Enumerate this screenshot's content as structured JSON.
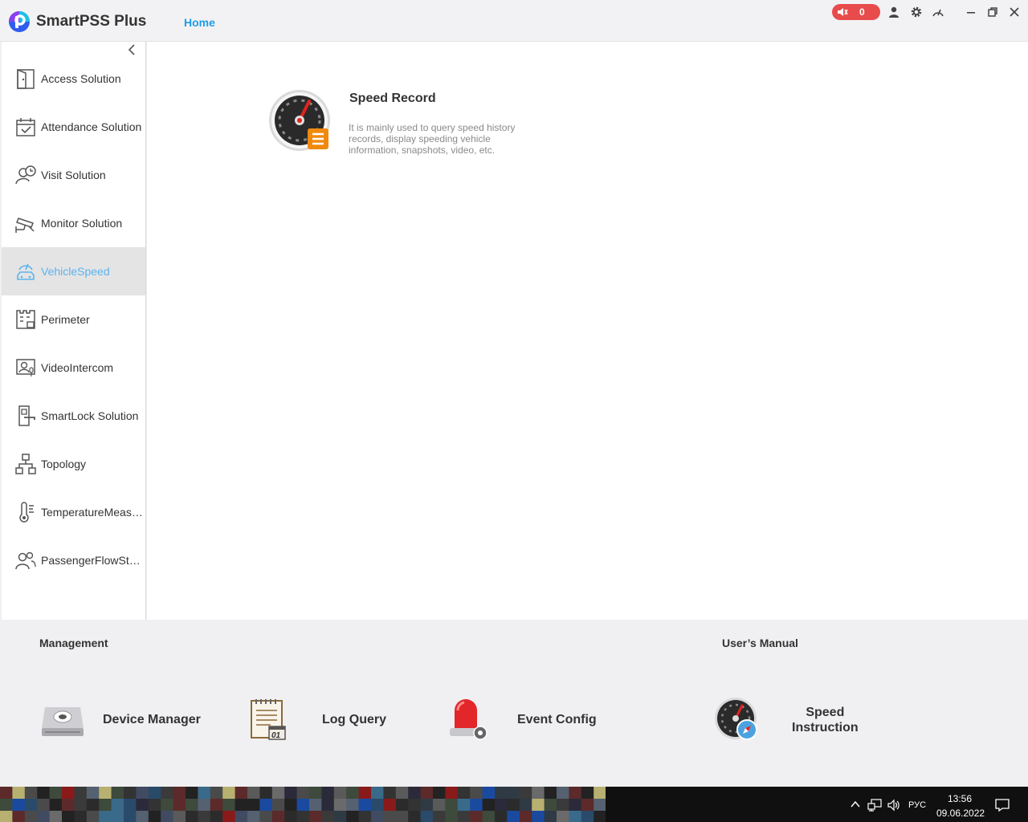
{
  "app": {
    "title": "SmartPSS Plus",
    "tab": "Home"
  },
  "alarm": {
    "count": "0"
  },
  "sidebar": {
    "items": [
      {
        "label": "Access Solution",
        "icon": "door-icon"
      },
      {
        "label": "Attendance Solution",
        "icon": "calendar-check-icon"
      },
      {
        "label": "Visit Solution",
        "icon": "visitor-clock-icon"
      },
      {
        "label": "Monitor Solution",
        "icon": "camera-icon"
      },
      {
        "label": "VehicleSpeed",
        "icon": "vehicle-speed-icon",
        "active": true
      },
      {
        "label": "Perimeter",
        "icon": "perimeter-icon"
      },
      {
        "label": "VideoIntercom",
        "icon": "intercom-icon"
      },
      {
        "label": "SmartLock Solution",
        "icon": "smartlock-icon"
      },
      {
        "label": "Topology",
        "icon": "topology-icon"
      },
      {
        "label": "TemperatureMeasurement",
        "icon": "thermometer-icon"
      },
      {
        "label": "PassengerFlowStatistics",
        "icon": "people-icon"
      }
    ]
  },
  "main": {
    "card": {
      "title": "Speed Record",
      "description": "It is mainly used to query speed history records, display speeding vehicle information, snapshots, video, etc."
    }
  },
  "bottom": {
    "management_title": "Management",
    "manual_title": "User’s Manual",
    "tiles": [
      {
        "label": "Device Manager",
        "icon": "device-manager-icon"
      },
      {
        "label": "Log Query",
        "icon": "log-query-icon"
      },
      {
        "label": "Event Config",
        "icon": "event-config-icon"
      }
    ],
    "manual": {
      "line1": "Speed",
      "line2": "Instruction"
    }
  },
  "taskbar": {
    "lang": "РУС",
    "time": "13:56",
    "date": "09.06.2022"
  },
  "colors": {
    "accent": "#1f9ce8",
    "alarm": "#e84b4b",
    "active_bg": "#e4e4e4"
  }
}
